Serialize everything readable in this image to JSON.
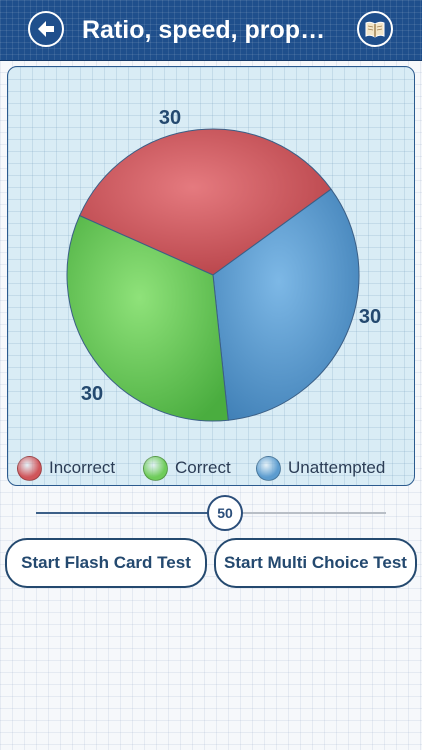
{
  "header": {
    "title": "Ratio, speed, prop…",
    "back_icon": "arrow-left-icon",
    "book_icon": "open-book-icon",
    "bar_color": "#1f4f8c"
  },
  "chart_data": {
    "type": "pie",
    "slices": [
      {
        "name": "Incorrect",
        "value": 30,
        "label": "30",
        "color": "#d0555a"
      },
      {
        "name": "Unattempted",
        "value": 30,
        "label": "30",
        "color": "#5c9ccf"
      },
      {
        "name": "Correct",
        "value": 30,
        "label": "30",
        "color": "#6fcc5a"
      }
    ],
    "legend": [
      "Incorrect",
      "Correct",
      "Unattempted"
    ],
    "legend_position": "bottom"
  },
  "legend": {
    "items": [
      {
        "label": "Incorrect",
        "color": "#d0555a"
      },
      {
        "label": "Correct",
        "color": "#6fcc5a"
      },
      {
        "label": "Unattempted",
        "color": "#5c9ccf"
      }
    ]
  },
  "slider": {
    "value_label": "50",
    "fraction": 0.54
  },
  "buttons": {
    "flash_card": "Start Flash Card Test",
    "multi_choice": "Start Multi Choice Test"
  }
}
